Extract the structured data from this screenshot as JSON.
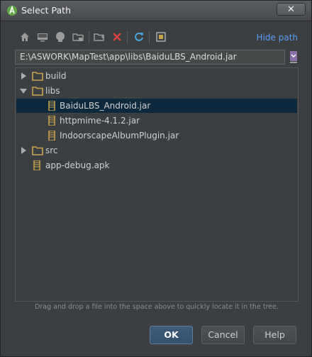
{
  "window": {
    "title": "Select Path",
    "close_label": "✕"
  },
  "toolbar": {
    "buttons": [
      {
        "name": "home-icon"
      },
      {
        "name": "desktop-icon"
      },
      {
        "name": "project-icon"
      },
      {
        "name": "module-folder-icon"
      },
      {
        "name": "new-folder-icon"
      },
      {
        "name": "delete-icon"
      },
      {
        "name": "refresh-icon"
      },
      {
        "name": "show-hidden-icon"
      }
    ],
    "hide_path_label": "Hide path"
  },
  "path": {
    "value": "E:\\ASWORK\\MapTest\\app\\libs\\BaiduLBS_Android.jar"
  },
  "tree": {
    "items": [
      {
        "label": "build",
        "type": "folder",
        "expanded": false,
        "depth": 0
      },
      {
        "label": "libs",
        "type": "folder",
        "expanded": true,
        "depth": 0
      },
      {
        "label": "BaiduLBS_Android.jar",
        "type": "jar",
        "depth": 1,
        "selected": true
      },
      {
        "label": "httpmime-4.1.2.jar",
        "type": "jar",
        "depth": 1
      },
      {
        "label": "IndoorscapeAlbumPlugin.jar",
        "type": "jar",
        "depth": 1
      },
      {
        "label": "src",
        "type": "folder",
        "expanded": false,
        "depth": 0
      },
      {
        "label": "app-debug.apk",
        "type": "apk",
        "depth": 0
      }
    ]
  },
  "hint": "Drag and drop a file into the space above to quickly locate it in the tree.",
  "buttons": {
    "ok": "OK",
    "cancel": "Cancel",
    "help": "Help"
  },
  "colors": {
    "selection": "#0d293e",
    "link": "#589df6",
    "folder": "#c9a34c",
    "delete": "#e04242",
    "refresh": "#4aa3e0"
  }
}
